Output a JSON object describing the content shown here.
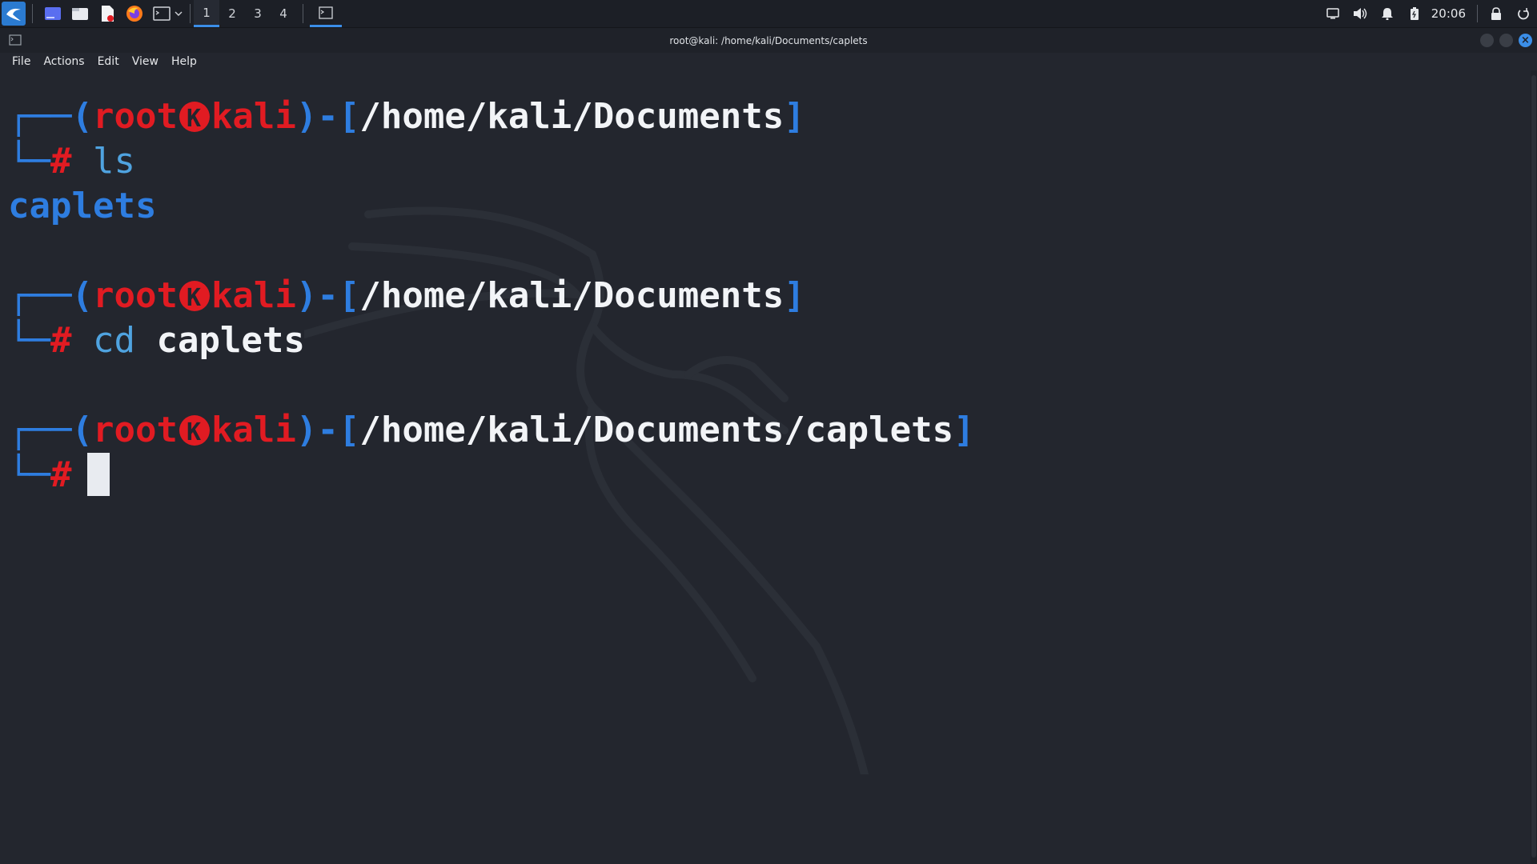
{
  "panel": {
    "workspaces": [
      "1",
      "2",
      "3",
      "4"
    ],
    "active_workspace": "1",
    "clock": "20:06",
    "launchers": [
      "kali-menu-icon",
      "desktop-icon",
      "file-manager-icon",
      "text-editor-icon",
      "firefox-icon",
      "terminal-icon"
    ],
    "tray": [
      "display-icon",
      "volume-icon",
      "bell-icon",
      "battery-icon",
      "lock-icon",
      "power-icon"
    ]
  },
  "window": {
    "title": "root@kali: /home/kali/Documents/caplets"
  },
  "menubar": {
    "file": "File",
    "actions": "Actions",
    "edit": "Edit",
    "view": "View",
    "help": "Help"
  },
  "terminal": {
    "prompt_user": "root",
    "prompt_host": "kali",
    "blocks": [
      {
        "path": "/home/kali/Documents",
        "cmd": "ls",
        "arg": "",
        "output": "caplets"
      },
      {
        "path": "/home/kali/Documents",
        "cmd": "cd",
        "arg": "caplets",
        "output": ""
      },
      {
        "path": "/home/kali/Documents/caplets",
        "cmd": "",
        "arg": "",
        "output": ""
      }
    ]
  },
  "colors": {
    "accent": "#2e7de0",
    "prompt_red": "#e11b22",
    "background": "#23262e"
  }
}
